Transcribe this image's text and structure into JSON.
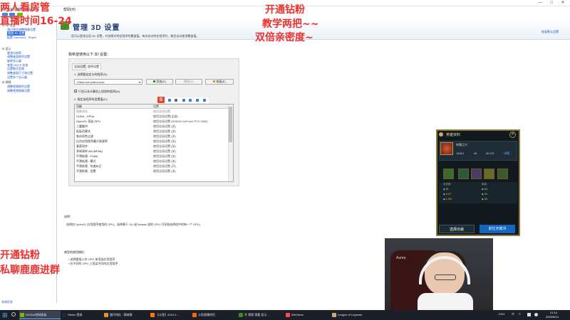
{
  "window": {
    "menu": [
      "文件(F)",
      "编辑(E)",
      "桌面(K)",
      "帮助(H)"
    ],
    "controls": {
      "minimize": "—",
      "maximize": "□",
      "close": "✕"
    }
  },
  "tree": {
    "items": [
      {
        "label": "3D 设置",
        "type": "cat"
      },
      {
        "label": "通过预览调整图像设置",
        "type": "item"
      },
      {
        "label": "管理 3D 设置",
        "type": "selected"
      },
      {
        "label": "配置 Surround、PhysX",
        "type": "item"
      },
      {
        "label": "显示",
        "type": "cat"
      },
      {
        "label": "更改分辨率",
        "type": "item"
      },
      {
        "label": "调整桌面颜色设置",
        "type": "item"
      },
      {
        "label": "旋转显示器",
        "type": "item"
      },
      {
        "label": "查看 HDCP 状态",
        "type": "item"
      },
      {
        "label": "设置数字音频",
        "type": "item"
      },
      {
        "label": "调整桌面尺寸和位置",
        "type": "item"
      },
      {
        "label": "设置多个显示器",
        "type": "item"
      },
      {
        "label": "视频",
        "type": "cat"
      },
      {
        "label": "调整视频颜色设置",
        "type": "item"
      },
      {
        "label": "调整视频图像设置",
        "type": "item"
      }
    ],
    "footer": "系统信息"
  },
  "main": {
    "title": "管理 3D 设置",
    "description": "您可以更改全局 3D 设置，并创建对特定程序的覆盖值。每次启动特定程序时，都会自动使用覆盖值。",
    "restore": "恢复默认设置",
    "intro": "我希望使用以下 3D 设置：",
    "tabs": [
      "全局设置",
      "程序设置"
    ],
    "step1": "1. 选择要自定义的程序(S):",
    "program": "Client.exe (client.exe)",
    "buttons": {
      "add": "添加(D)",
      "remove": "删除(R)",
      "restore": "恢复(E)"
    },
    "checkbox": "只显示本计算机上找到的程序(M)",
    "step2": "2. 指定该程序的设置值(C):",
    "columns": [
      "功能",
      "设置"
    ],
    "rows": [
      {
        "feature": "图像锐化",
        "value": "使用全局设置",
        "dim": true
      },
      {
        "feature": "CUDA - GPUs",
        "value": "使用全局设置(全部)",
        "dim": false
      },
      {
        "feature": "OpenGL 渲染 GPU",
        "value": "使用全局设置 (NVIDIA GeForce RTX 3060)",
        "dim": false
      },
      {
        "feature": "三重缓冲",
        "value": "使用全局设置 (关)",
        "dim": false
      },
      {
        "feature": "低延迟模式",
        "value": "使用全局设置 (关)",
        "dim": false
      },
      {
        "feature": "各向异性过滤",
        "value": "使用全局设置 (关)",
        "dim": false
      },
      {
        "feature": "后台应用程序最大帧速率",
        "value": "使用全局设置 (关)",
        "dim": false
      },
      {
        "feature": "垂直同步",
        "value": "使用全局设置 (关)",
        "dim": false
      },
      {
        "feature": "多帧采样 AA (MFAA)",
        "value": "使用全局设置 (关)",
        "dim": false
      },
      {
        "feature": "平滑处理 - FXAA",
        "value": "使用全局设置 (关)",
        "dim": false
      },
      {
        "feature": "平滑处理 - 模式",
        "value": "使用全局设置 (关)",
        "dim": false
      },
      {
        "feature": "平滑处理 - 灰度纠正",
        "value": "使用全局设置 (开)",
        "dim": false
      },
      {
        "feature": "平滑处理 - 设置",
        "value": "使用全局设置 (关)",
        "dim": false
      }
    ],
    "desc_title": "说明：",
    "desc_text": "选择由 OpenGL 应用程序使用的 GPU。选择属于 SLI 或 Mosaic 组的 GPU 可导致选择组中的每一个 GPU。",
    "usage_title": "典型的使用情形：",
    "usage": [
      "选择要插入的 GPU 来渲染应用程序",
      "在不同的 GPU 上渲染不同的应用程序"
    ]
  },
  "overlay": {
    "top_left_1": "两人看房管",
    "top_left_2": "直播时间16-24",
    "top_center_1": "开通钻粉",
    "top_center_2": "教学两把~~",
    "top_center_3": "双倍亲密度~",
    "bottom_left_1": "开通钻粉",
    "bottom_left_2": "私聊鹿鹿进群"
  },
  "game": {
    "title": "英雄资料",
    "champion": "刺猬之兴",
    "stats": [
      "14512",
      "46",
      "65.2%"
    ],
    "detail_link": "详情",
    "left_stats": [
      "51",
      "0.47",
      "1.0%"
    ],
    "right_stats": [
      "64",
      "29",
      "30"
    ],
    "left_stat_labels": [
      "击杀数",
      "KDA",
      "三杀"
    ],
    "right_stat_labels": [
      "助攻",
      "死亡",
      "参团"
    ],
    "btn_left": "选择出装",
    "btn_right": "前往天赋书",
    "colors": {
      "border": "#8a7a3a",
      "btn_left": "#1d2c34",
      "btn_right": "#1565c0"
    }
  },
  "webcam": {
    "chair_logo": "Aurea"
  },
  "taskbar": {
    "tasks": [
      {
        "label": "NVIDIA控制面板",
        "color": "#76b900",
        "active": true
      },
      {
        "label": "Steam 登录",
        "color": "#1b2838",
        "active": false
      },
      {
        "label": "蛋仔排队 - 萌妹哦",
        "color": "#f38b2b",
        "active": false
      },
      {
        "label": "【斗鱼】2010-2...",
        "color": "#ff7a00",
        "active": false
      },
      {
        "label": "斗鱼直播伴侣",
        "color": "#ff6600",
        "active": false
      },
      {
        "label": "开 视频 观看 显示...",
        "color": "#3c8b24",
        "active": false
      },
      {
        "label": "WeGame",
        "color": "#ff4a4a",
        "active": false
      },
      {
        "label": "League of Legends",
        "color": "#c8aa6e",
        "active": false
      }
    ],
    "tray": [
      "ENG",
      "中",
      "S"
    ],
    "time": "21:14",
    "date": "2022/9/14"
  }
}
